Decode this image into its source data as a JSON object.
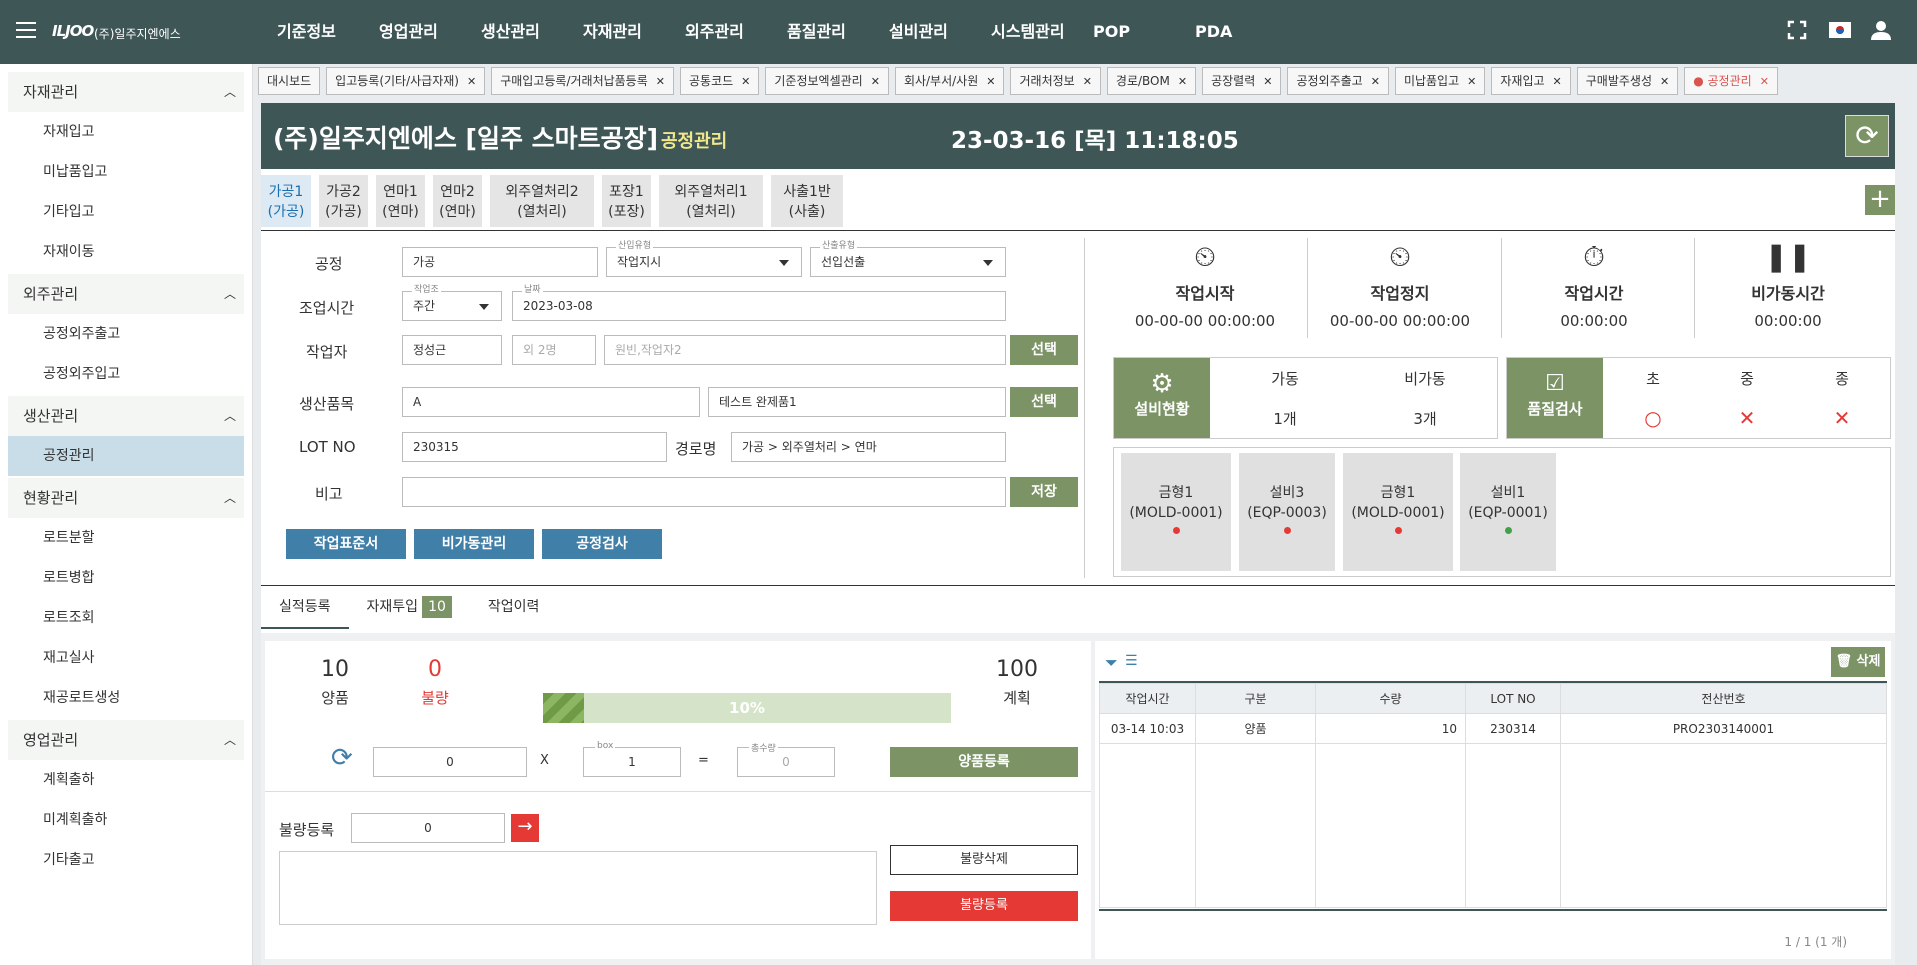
{
  "topbar": {
    "logo": "ILJOO",
    "company": "(주)일주지엔에스",
    "menu": [
      "기준정보",
      "영업관리",
      "생산관리",
      "자재관리",
      "외주관리",
      "품질관리",
      "설비관리",
      "시스템관리",
      "POP",
      "PDA"
    ]
  },
  "sidebar": {
    "groups": [
      {
        "label": "자재관리",
        "items": [
          "자재입고",
          "미납품입고",
          "기타입고",
          "자재이동"
        ]
      },
      {
        "label": "외주관리",
        "items": [
          "공정외주출고",
          "공정외주입고"
        ]
      },
      {
        "label": "생산관리",
        "items": [
          "공정관리"
        ]
      },
      {
        "label": "현황관리",
        "items": [
          "로트분할",
          "로트병합",
          "로트조회",
          "재고실사",
          "재공로트생성"
        ]
      },
      {
        "label": "영업관리",
        "items": [
          "계획출하",
          "미계획출하",
          "기타출고"
        ]
      }
    ],
    "active_item": "공정관리"
  },
  "tabs": [
    "대시보드",
    "입고등록(기타/사급자재)",
    "구매입고등록/거래처납품등록",
    "공통코드",
    "기준정보엑셀관리",
    "회사/부서/사원",
    "거래처정보",
    "경로/BOM",
    "공장렬력",
    "공정외주출고",
    "미납품입고",
    "자재입고",
    "구매발주생성",
    "공정관리"
  ],
  "header": {
    "title": "(주)일주지엔에스 [일주 스마트공장]",
    "subtitle": "공정관리",
    "datetime": "23-03-16 [목] 11:18:05"
  },
  "process_tabs": [
    {
      "l1": "가공1",
      "l2": "(가공)"
    },
    {
      "l1": "가공2",
      "l2": "(가공)"
    },
    {
      "l1": "연마1",
      "l2": "(연마)"
    },
    {
      "l1": "연마2",
      "l2": "(연마)"
    },
    {
      "l1": "외주열처리2",
      "l2": "(열처리)"
    },
    {
      "l1": "포장1",
      "l2": "(포장)"
    },
    {
      "l1": "외주열처리1",
      "l2": "(열처리)"
    },
    {
      "l1": "사출1반",
      "l2": "(사출)"
    }
  ],
  "form": {
    "process_label": "공정",
    "process_value": "가공",
    "input_type_label": "산입유형",
    "input_type_value": "작업지시",
    "output_type_label": "산출유형",
    "output_type_value": "선입선출",
    "work_time_label": "조업시간",
    "shift_label": "작업조",
    "shift_value": "주간",
    "date_label": "날짜",
    "date_value": "2023-03-08",
    "worker_label": "작업자",
    "worker_value": "정성근",
    "worker_extra": "외 2명",
    "worker_placeholder": "원빈,작업자2",
    "select_btn": "선택",
    "product_label": "생산품목",
    "product_code": "A",
    "product_name": "테스트 완제품1",
    "lot_label": "LOT NO",
    "lot_value": "230315",
    "route_label": "경로명",
    "route_value": "가공 > 외주열처리 > 연마",
    "note_label": "비고",
    "save_btn": "저장",
    "btn_standard": "작업표준서",
    "btn_downtime": "비가동관리",
    "btn_inspect": "공정검사"
  },
  "stats": [
    {
      "title": "작업시작",
      "value": "00-00-00 00:00:00"
    },
    {
      "title": "작업정지",
      "value": "00-00-00 00:00:00"
    },
    {
      "title": "작업시간",
      "value": "00:00:00"
    },
    {
      "title": "비가동시간",
      "value": "00:00:00"
    }
  ],
  "equipment": {
    "label": "설비현황",
    "running_label": "가동",
    "running_value": "1개",
    "idle_label": "비가동",
    "idle_value": "3개"
  },
  "quality": {
    "label": "품질검사",
    "first": "초",
    "middle": "중",
    "last": "종",
    "first_mark": "○",
    "middle_mark": "✕",
    "last_mark": "✕"
  },
  "devices": [
    {
      "name": "금형1",
      "code": "(MOLD-0001)",
      "status_color": "#e53935"
    },
    {
      "name": "설비3",
      "code": "(EQP-0003)",
      "status_color": "#e53935"
    },
    {
      "name": "금형1",
      "code": "(MOLD-0001)",
      "status_color": "#e53935"
    },
    {
      "name": "설비1",
      "code": "(EQP-0001)",
      "status_color": "#43a047"
    }
  ],
  "bottom_tabs": {
    "perf": "실적등록",
    "material": "자재투입",
    "material_count": "10",
    "history": "작업이력"
  },
  "performance": {
    "good": "10",
    "good_label": "양품",
    "bad": "0",
    "bad_label": "불량",
    "plan": "100",
    "plan_label": "계획",
    "progress_pct": 10,
    "progress_text": "10%",
    "qty_value": "0",
    "times": "X",
    "box_label": "box",
    "box_value": "1",
    "equals": "=",
    "total_label": "총수량",
    "total_value": "0",
    "good_register_btn": "양품등록",
    "defect_label": "불량등록",
    "defect_value": "0",
    "defect_delete_btn": "불량삭제",
    "defect_register_btn": "불량등록"
  },
  "records": {
    "delete_btn": "삭제",
    "headers": [
      "작업시간",
      "구분",
      "수량",
      "LOT NO",
      "전산번호"
    ],
    "rows": [
      [
        "03-14 10:03",
        "양품",
        "10",
        "230314",
        "PRO2303140001"
      ]
    ],
    "pagination": "1 / 1 (1 개)"
  }
}
